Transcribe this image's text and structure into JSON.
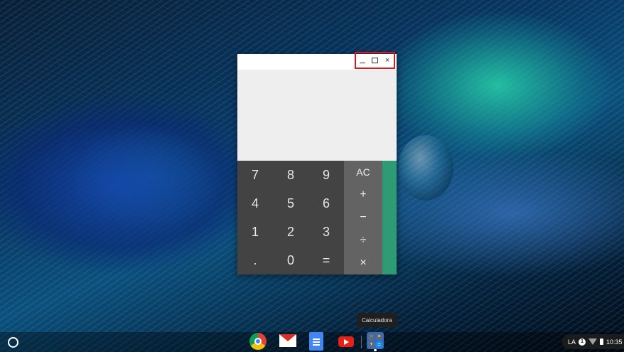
{
  "calculator": {
    "keys": [
      {
        "label": "7",
        "name": "key-7"
      },
      {
        "label": "8",
        "name": "key-8"
      },
      {
        "label": "9",
        "name": "key-9"
      },
      {
        "label": "4",
        "name": "key-4"
      },
      {
        "label": "5",
        "name": "key-5"
      },
      {
        "label": "6",
        "name": "key-6"
      },
      {
        "label": "1",
        "name": "key-1"
      },
      {
        "label": "2",
        "name": "key-2"
      },
      {
        "label": "3",
        "name": "key-3"
      },
      {
        "label": ".",
        "name": "key-decimal"
      },
      {
        "label": "0",
        "name": "key-0"
      },
      {
        "label": "=",
        "name": "key-equals"
      }
    ],
    "ops": {
      "clear": "AC",
      "add": "+",
      "subtract": "−",
      "divide": "÷",
      "multiply": "×"
    },
    "window_controls": {
      "close": "×"
    }
  },
  "tooltip": "Calculadora",
  "tray": {
    "input_method": "LA",
    "notification_count": "1",
    "time": "10:35"
  },
  "icons": {
    "launcher": "launcher-icon",
    "apps": [
      "chrome-icon",
      "gmail-icon",
      "docs-icon",
      "youtube-icon",
      "calculator-icon"
    ],
    "status": [
      "wifi-icon",
      "battery-icon"
    ]
  },
  "colors": {
    "numpad": "#434343",
    "ops_panel": "#636363",
    "drawer": "#2f9b74",
    "display": "#eeeeee",
    "highlight_box": "#e0161d"
  }
}
